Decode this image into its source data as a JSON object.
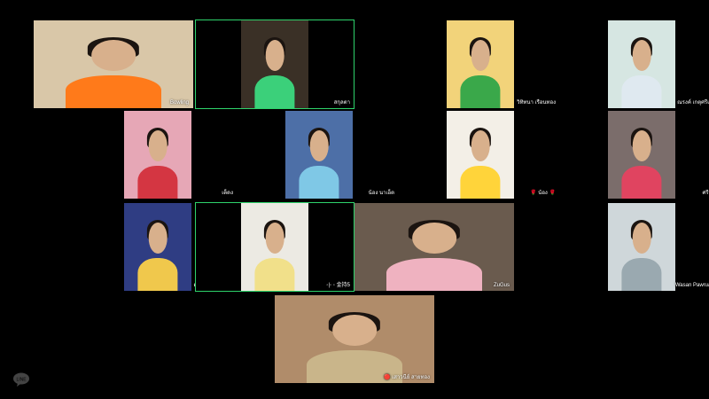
{
  "participants": [
    {
      "name": "Bowling",
      "bg": "#d9c7a8",
      "shirt": "#ff7a1a",
      "active": false
    },
    {
      "name": "สกุลตา",
      "bg": "#3a3026",
      "shirt": "#3bd07a",
      "active": true
    },
    {
      "name": "วิทิทนา เรือนทอง",
      "bg": "#f2d37a",
      "shirt": "#3aa84a",
      "active": false
    },
    {
      "name": "ณรงค์ เกตุศรีแก้ว",
      "bg": "#d6e6e2",
      "shirt": "#dfe9f0",
      "active": false
    },
    {
      "name": "เต็ดง",
      "bg": "#e6a7b6",
      "shirt": "#d43642",
      "active": false
    },
    {
      "name": "น้อง นาเอ็ต",
      "bg": "#4d6fa7",
      "shirt": "#7fc8e6",
      "active": false
    },
    {
      "name": "🌹 น้อง 🌹",
      "bg": "#f3efe7",
      "shirt": "#ffd43a",
      "active": false
    },
    {
      "name": "ศรีมณี",
      "bg": "#7b6d6b",
      "shirt": "#e04460",
      "active": false
    },
    {
      "name": "ด.ญ.สุพิชชา ลี้ลีม",
      "bg": "#2f3d83",
      "shirt": "#f0c84c",
      "active": false
    },
    {
      "name": "◦|◦ ◦ 金持5",
      "bg": "#eceae3",
      "shirt": "#f1e08a",
      "active": true
    },
    {
      "name": "ZuGus",
      "bg": "#6a5b4e",
      "shirt": "#efb2c0",
      "active": false
    },
    {
      "name": "Wasan Pawruang",
      "bg": "#cfd7da",
      "shirt": "#9aa9b0",
      "active": false
    },
    {
      "name": "🔴 เสาวนีย์ สายทอง",
      "bg": "#b08c6a",
      "shirt": "#c9b58a",
      "active": false
    }
  ],
  "app_logo_icon": "line-icon"
}
